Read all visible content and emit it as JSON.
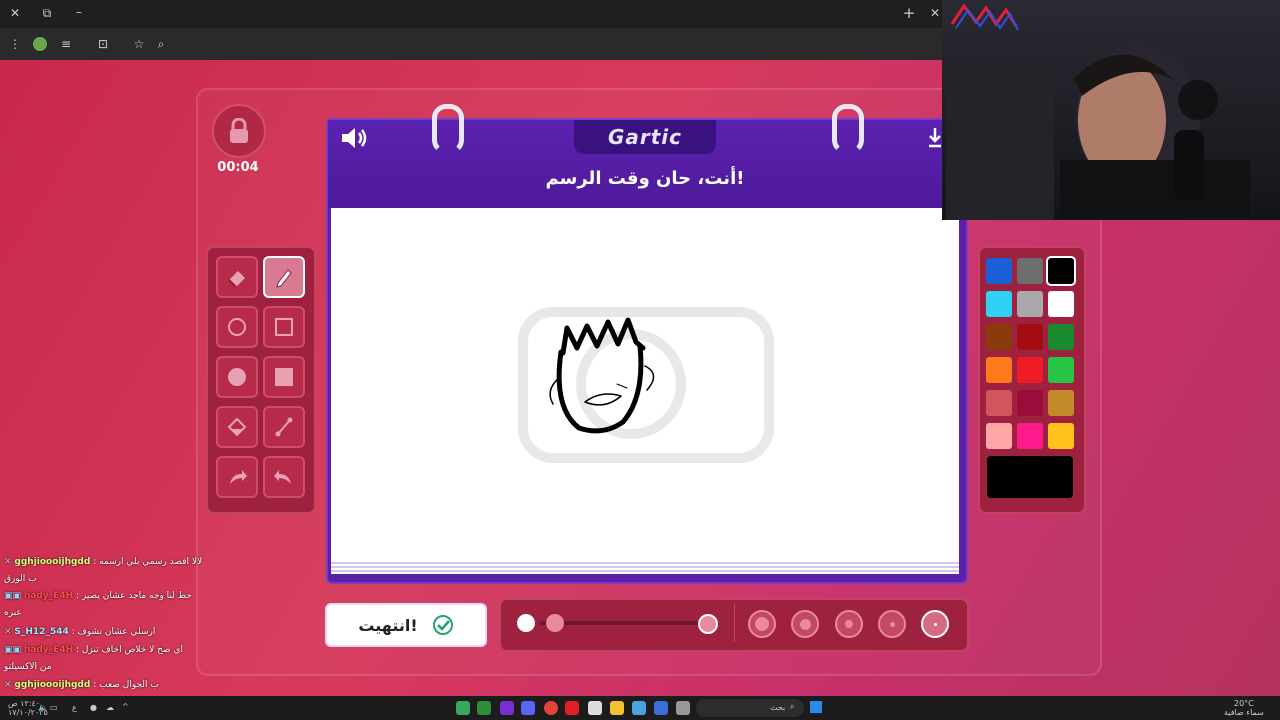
{
  "timer": "00:04",
  "board": {
    "logo": "Gartic",
    "title": "أنت، حان وقت الرسم!"
  },
  "done_button": {
    "label": "انتهيت!"
  },
  "tools": [
    "eraser",
    "pencil",
    "circle-outline",
    "square-outline",
    "circle-filled",
    "square-filled",
    "fill-bucket",
    "line",
    "undo",
    "redo"
  ],
  "active_tool": "pencil",
  "palette": {
    "colors": [
      "#1a5fd6",
      "#6e6e6e",
      "#000000",
      "#2ed2f5",
      "#a9a9a9",
      "#ffffff",
      "#8b3a0e",
      "#a30d12",
      "#1b8a2e",
      "#ff7a1a",
      "#ee1c24",
      "#28c446",
      "#d0555c",
      "#9a0c3c",
      "#c28a2a",
      "#ffa6a6",
      "#ff1a8c",
      "#ffc21f"
    ],
    "selected": "#000000",
    "current_color": "#000000"
  },
  "chat": [
    {
      "user": "gghjioooijhgdd",
      "message": "لالا اقصد رسمي بلي ارسمه",
      "cont": "ب الورق",
      "user_class": "a"
    },
    {
      "user": "hady_E4H",
      "message": "حط لنا وجه ماجد عشان يصير",
      "cont": "عبره",
      "user_class": "b"
    },
    {
      "user": "S_H12_544",
      "message": "ارسلي عشان نشوف",
      "cont": "",
      "user_class": "c"
    },
    {
      "user": "hady_E4H",
      "message": "اي صح لا خلاص اخاف تنزل",
      "cont": "من الاكسيلتو",
      "user_class": "b"
    },
    {
      "user": "gghjioooijhgdd",
      "message": "ب الجوال صعب",
      "cont": "",
      "user_class": "a"
    }
  ],
  "taskbar": {
    "search_placeholder": "بحث",
    "clock_time": "١٢:٤٠ ص",
    "clock_date": "١٧/١٠/٢٠٢٥",
    "weather_temp": "20°C",
    "weather_desc": "سماء صافية",
    "lang": "ع"
  }
}
